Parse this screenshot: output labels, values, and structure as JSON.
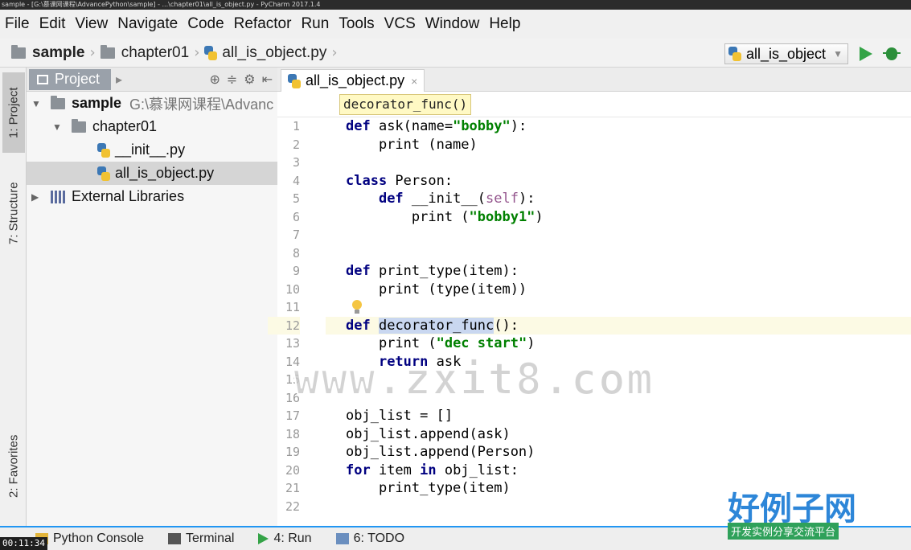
{
  "window": {
    "title": "sample - [G:\\慕课网课程\\AdvancePython\\sample] - ...\\chapter01\\all_is_object.py - PyCharm 2017.1.4"
  },
  "menu": [
    "File",
    "Edit",
    "View",
    "Navigate",
    "Code",
    "Refactor",
    "Run",
    "Tools",
    "VCS",
    "Window",
    "Help"
  ],
  "navbar": {
    "crumbs": [
      "sample",
      "chapter01",
      "all_is_object.py"
    ],
    "run_config": "all_is_object"
  },
  "left_strip": {
    "project_tab": "1: Project",
    "structure_tab": "7: Structure",
    "favorites_tab": "2: Favorites"
  },
  "project_panel": {
    "tab_label": "Project",
    "tree": [
      {
        "label": "sample",
        "path": "G:\\慕课网课程\\Advanc"
      },
      {
        "label": "chapter01"
      },
      {
        "label": "__init__.py"
      },
      {
        "label": "all_is_object.py"
      },
      {
        "label": "External Libraries"
      }
    ]
  },
  "editor": {
    "tab_label": "all_is_object.py",
    "breadcrumb": "decorator_func()",
    "line_numbers": [
      "1",
      "2",
      "3",
      "4",
      "5",
      "6",
      "7",
      "8",
      "9",
      "10",
      "11",
      "12",
      "13",
      "14",
      "15",
      "16",
      "17",
      "18",
      "19",
      "20",
      "21",
      "22"
    ]
  },
  "bottom_tabs": [
    "Python Console",
    "Terminal",
    "4: Run",
    "6: TODO"
  ],
  "timestamp": "00:11:34",
  "watermarks": {
    "center": "www.zxit8.com",
    "logo": "好例子网",
    "logo_sub": "开发实例分享交流平台"
  },
  "colors": {
    "keyword": "#000080",
    "string": "#008000",
    "self": "#94558d",
    "accent": "#2196f3"
  }
}
